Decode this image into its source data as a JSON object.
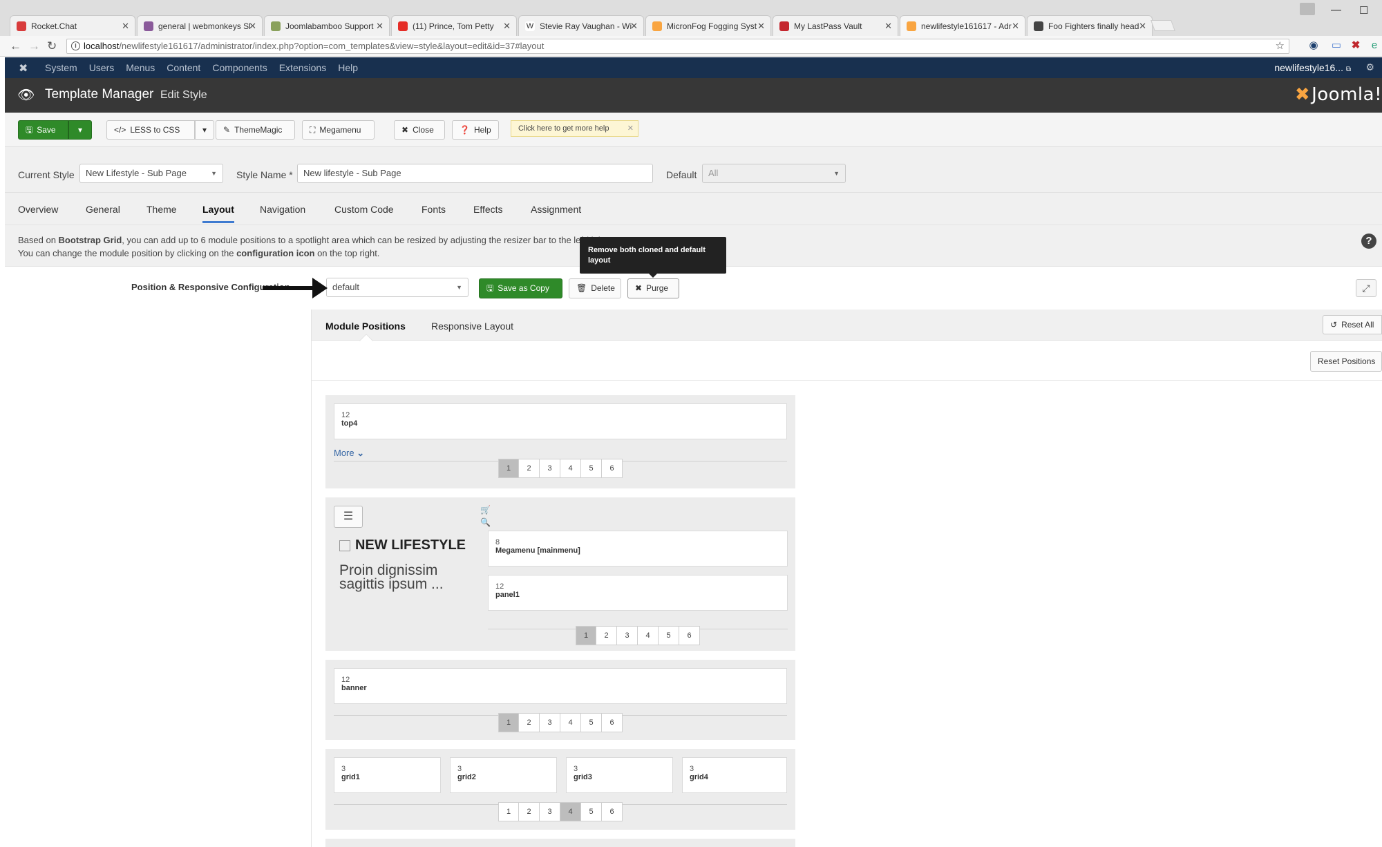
{
  "browser": {
    "tabs": [
      {
        "title": "Rocket.Chat",
        "color": "#d83b3b"
      },
      {
        "title": "general | webmonkeys Sl",
        "color": "#8a5a9a"
      },
      {
        "title": "Joomlabamboo Support",
        "color": "#8aa15c"
      },
      {
        "title": "(11) Prince, Tom Petty",
        "color": "#e52d27"
      },
      {
        "title": "Stevie Ray Vaughan - Wi",
        "color": "#ffffff"
      },
      {
        "title": "MicronFog Fogging Syst",
        "color": "#f9a541"
      },
      {
        "title": "My LastPass Vault",
        "color": "#c4262e"
      },
      {
        "title": "newlifestyle161617 - Adr",
        "color": "#f9a541"
      },
      {
        "title": "Foo Fighters finally head",
        "color": "#444444"
      }
    ],
    "url_host": "localhost",
    "url_path": "/newlifestyle161617/administrator/index.php?option=com_templates&view=style&layout=edit&id=37#layout"
  },
  "admin_menu": {
    "items": [
      "System",
      "Users",
      "Menus",
      "Content",
      "Components",
      "Extensions",
      "Help"
    ],
    "user": "newlifestyle16..."
  },
  "header": {
    "title": "Template Manager",
    "subtitle": "Edit Style",
    "brand": "Joomla!"
  },
  "toolbar": {
    "save": "Save",
    "less_to_css": "LESS to CSS",
    "thememagic": "ThemeMagic",
    "megamenu": "Megamenu",
    "close": "Close",
    "help": "Help",
    "help_tip": "Click here to get more help"
  },
  "style": {
    "current_style_label": "Current Style",
    "current_style_value": "New Lifestyle - Sub Page",
    "style_name_label": "Style Name *",
    "style_name_value": "New lifestyle  - Sub Page",
    "default_label": "Default",
    "default_value": "All"
  },
  "tabs": [
    "Overview",
    "General",
    "Theme",
    "Layout",
    "Navigation",
    "Custom Code",
    "Fonts",
    "Effects",
    "Assignment"
  ],
  "notice": {
    "line1_a": "Based on ",
    "line1_b": "Bootstrap Grid",
    "line1_c": ", you can add up to 6 module positions to a spotlight area which can be resized by adjusting the resizer bar to the left/right.",
    "line2_a": "You can change the module position by clicking on the ",
    "line2_b": "configuration icon",
    "line2_c": " on the top right."
  },
  "tooltip": "Remove both cloned and default layout",
  "config": {
    "label": "Position & Responsive Configuration",
    "layout_value": "default",
    "save_as_copy": "Save as Copy",
    "delete": "Delete",
    "purge": "Purge"
  },
  "subtabs": {
    "module_positions": "Module Positions",
    "responsive_layout": "Responsive Layout",
    "reset_all": "Reset All",
    "reset_positions": "Reset Positions"
  },
  "sections": {
    "top": {
      "size": "12",
      "name": "top4",
      "more": "More"
    },
    "header": {
      "logo": "NEW LIFESTYLE",
      "tagline": "Proin dignissim sagittis ipsum ...",
      "megamenu_size": "8",
      "megamenu_name": "Megamenu [mainmenu]",
      "panel_size": "12",
      "panel_name": "panel1"
    },
    "banner": {
      "size": "12",
      "name": "banner"
    },
    "grid": [
      {
        "size": "3",
        "name": "grid1"
      },
      {
        "size": "3",
        "name": "grid2"
      },
      {
        "size": "3",
        "name": "grid3"
      },
      {
        "size": "3",
        "name": "grid4"
      }
    ],
    "pager_numbers": [
      "1",
      "2",
      "3",
      "4",
      "5",
      "6"
    ]
  }
}
